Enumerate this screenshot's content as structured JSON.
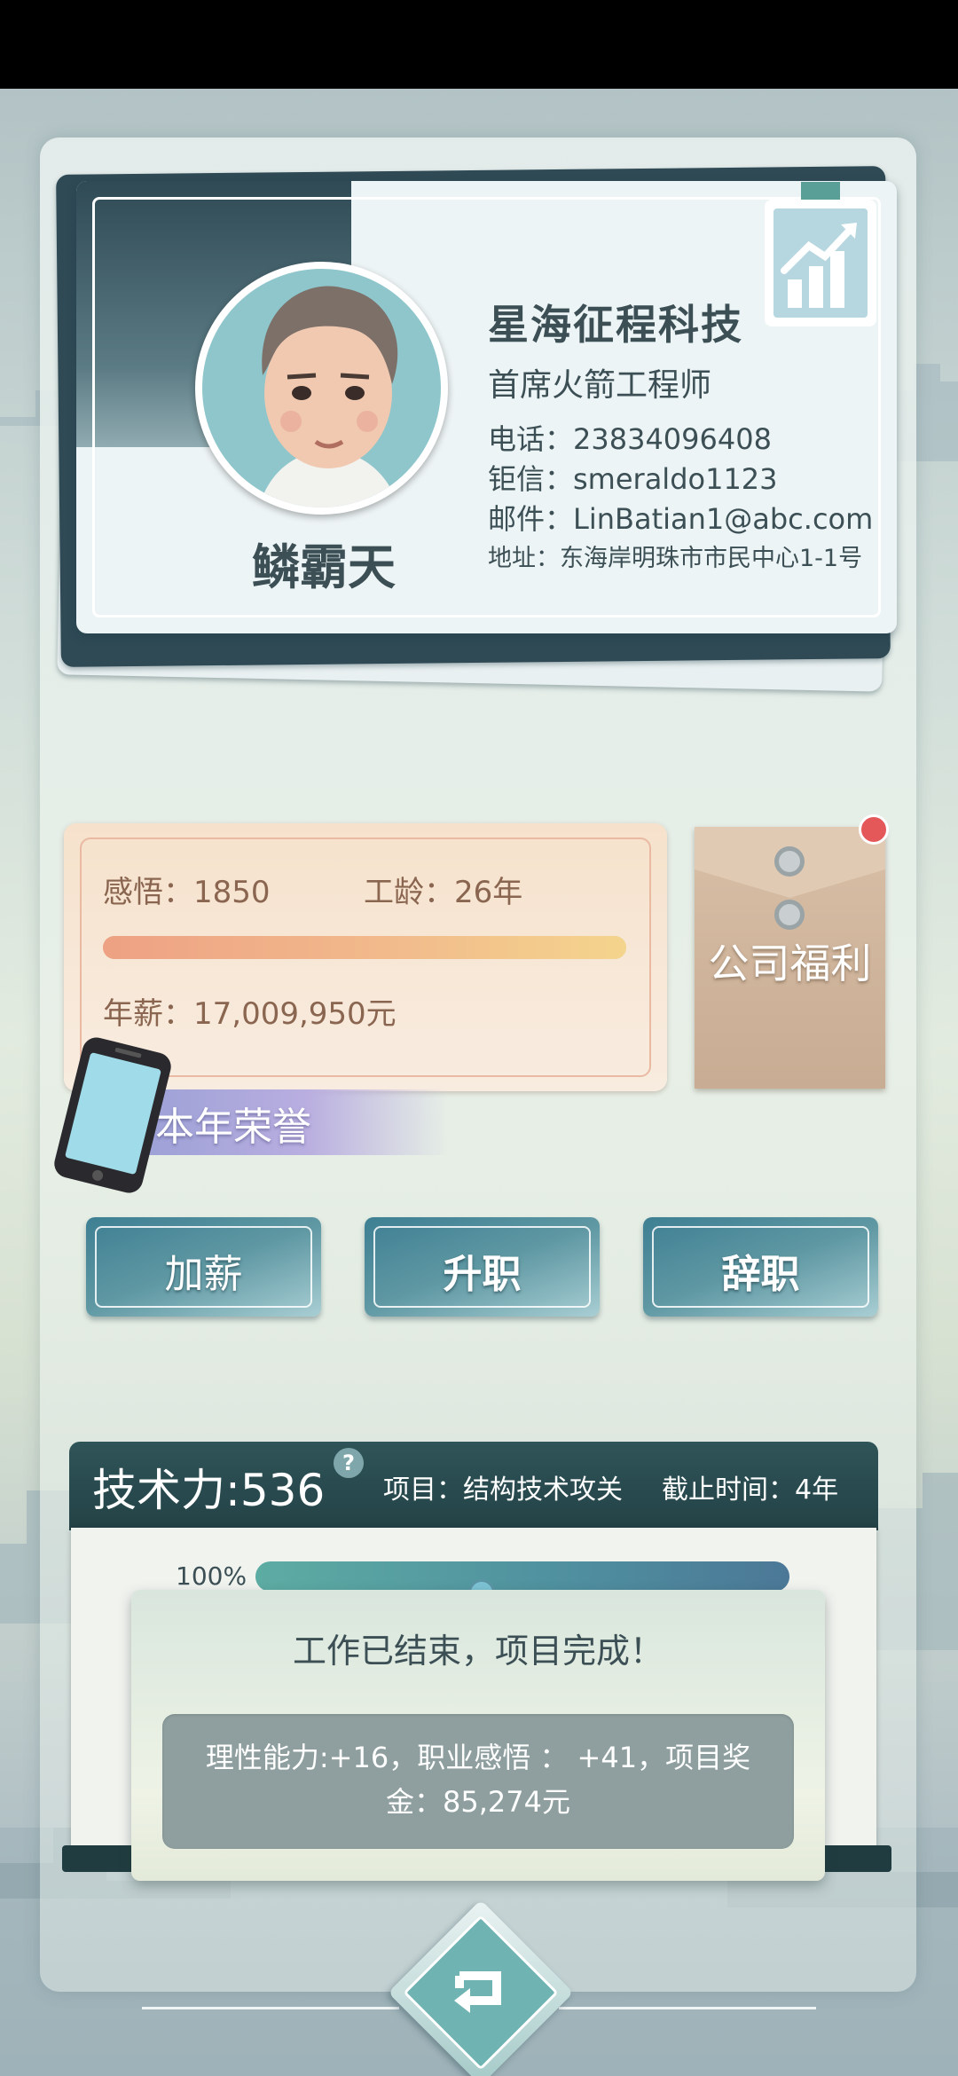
{
  "card": {
    "name": "鳞霸天",
    "company": "星海征程科技",
    "job_title": "首席火箭工程师",
    "phone": "电话：23834096408",
    "messenger": "钜信：smeraldo1123",
    "email": "邮件：LinBatian1@abc.com",
    "address": "地址：东海岸明珠市市民中心1-1号"
  },
  "stats": {
    "insight": "感悟：1850",
    "seniority": "工龄：26年",
    "salary": "年薪：17,009,950元",
    "progress_fraction": 1.0
  },
  "welfare": {
    "label": "公司福利",
    "has_notification": true
  },
  "honor": {
    "label": "本年荣誉"
  },
  "actions": [
    {
      "label": "加薪"
    },
    {
      "label": "升职"
    },
    {
      "label": "辞职"
    }
  ],
  "project": {
    "tech_power": "技术力:536",
    "help_glyph": "?",
    "name": "项目：结构技术攻关",
    "deadline": "截止时间：4年",
    "percent_label": "100%",
    "progress_fraction": 1.0
  },
  "popup": {
    "title": "工作已结束，项目完成！",
    "result": "理性能力:+16，职业感悟 ： +41，项目奖金：85,274元"
  },
  "icons": {
    "back": "return-arrow-icon",
    "phone": "smartphone-icon",
    "chart": "growth-chart-icon"
  },
  "colors": {
    "accent": "#2f5458",
    "text": "#3b4f55",
    "welfare_dot": "#e4585a"
  }
}
